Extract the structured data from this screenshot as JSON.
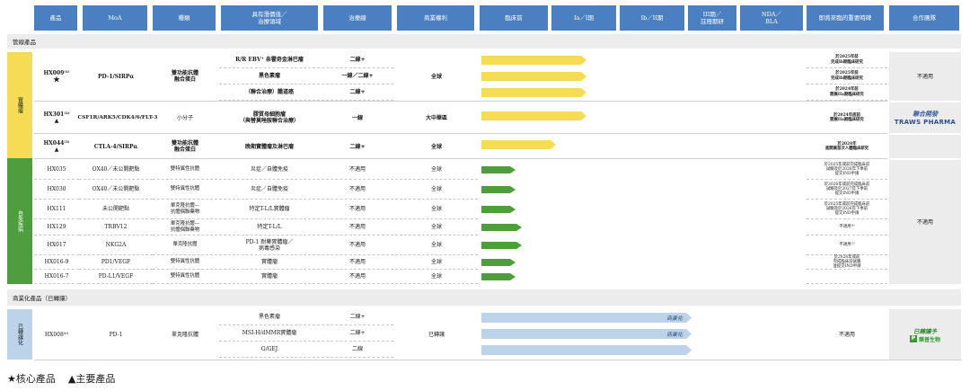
{
  "headers": [
    "產品",
    "MoA",
    "種類",
    "具有潛價值／\n治療領域",
    "治療線",
    "商業權利",
    "臨床前",
    "Ia／I期",
    "Ib／II期",
    "III期／\n註冊期研",
    "NDA／\nBLA",
    "即將來臨的重要時碑",
    "合作團隊"
  ],
  "sections": {
    "pipeline": "管線產品",
    "commercial": "商業化產品（已轉讓）"
  },
  "groups": {
    "yellow": "實體瘤",
    "green": "自免疾病",
    "blue": "已轉讓化"
  },
  "yellow_rows": [
    {
      "product": "",
      "moa": "",
      "type": "",
      "indication": "R/R EBV⁺ 亲霍奇金淋巴瘤",
      "line": "二線+",
      "rights": "",
      "stage": 0.34,
      "milestone": "於2025年前\n完成Ib期臨床研究"
    },
    {
      "product": "",
      "moa": "",
      "type": "",
      "indication": "黑色素瘤",
      "line": "一線／二線+",
      "rights": "",
      "stage": 0.34,
      "milestone": "於2025年前\n完成Ib期臨床研究"
    },
    {
      "product": "",
      "moa": "",
      "type": "",
      "indication": "（聯合治療）膽道癌",
      "line": "二線+",
      "rights": "",
      "stage": 0.34,
      "milestone": "於2024年前\n開展IIa期臨床研究"
    },
    {
      "product": "",
      "moa": "",
      "type": "",
      "indication": "",
      "line": "",
      "rights": "",
      "stage": 0.0,
      "milestone": ""
    },
    {
      "product": "",
      "moa": "",
      "type": "",
      "indication": "",
      "line": "",
      "rights": "",
      "stage": 0.0,
      "milestone": ""
    }
  ],
  "hx009": {
    "name": "HX009⁽¹⁾",
    "mark": "★",
    "moa": "PD-1/SIRPα",
    "type": "雙功能抗體\n融合蛋白",
    "rights": "全球",
    "partner": "不適用"
  },
  "hx301": {
    "name": "HX301⁽²⁾",
    "mark": "▲",
    "moa": "CSF1R/ARK5/CDK4/6/FLT-3",
    "type": "小分子",
    "indication": "膠質母細胞瘤\n（與替莫唑胺聯合治療）",
    "line": "一線",
    "rights": "大中華區",
    "stage": 0.34,
    "milestone": "於2024年底前\n開展IIa期臨床研究"
  },
  "hx044": {
    "name": "HX044⁽³⁾",
    "mark": "▲",
    "moa": "CTLA-4/SIRPα",
    "type": "雙功能抗體\n融合蛋白",
    "indication": "晚期實體瘤及淋巴瘤",
    "line": "二線+",
    "rights": "全球",
    "stage": 0.24,
    "milestone": "於2024年\n底開展首次人體臨床研究"
  },
  "partners": {
    "yellow_top": "不適用",
    "traws_top": "聯合開發",
    "traws_logo": "TRAWS PHARMA",
    "green": "不適用",
    "blue": "已轉讓予",
    "blue_logo": "樂普生物"
  },
  "green_rows": [
    {
      "product": "HX035",
      "moa": "OX40／未公開靶點",
      "type": "雙特異性抗體",
      "indication": "炎症／自體免疫",
      "line": "不適用",
      "rights": "全球",
      "stage": 0.11,
      "milestone": "於2025年或前完成臨床前\n試驗及於2026年下季前\n提交IND申請"
    },
    {
      "product": "HX030",
      "moa": "OX40／未公開靶點",
      "type": "雙特異性抗體",
      "indication": "炎症／自體免疫",
      "line": "不適用",
      "rights": "全球",
      "stage": 0.11,
      "milestone": "於2026年或前完成臨床前\n試驗及於2027年下季前\n提交IND申請"
    },
    {
      "product": "HX111",
      "moa": "未公開靶點",
      "type": "單克隆抗體—\n抗體偶聯藥物",
      "indication": "特定T-L/L實體瘤",
      "line": "不適用",
      "rights": "全球",
      "stage": 0.11,
      "milestone": "於2025年或前完成臨床前\n試驗及於2026年下季前\n提交IND申請"
    },
    {
      "product": "HX129",
      "moa": "TRBV12",
      "type": "單克隆抗體—\n抗體偶聯藥物",
      "indication": "特定T-L/L",
      "line": "不適用",
      "rights": "全球",
      "stage": 0.13,
      "milestone": "不適用⁽⁴⁾"
    },
    {
      "product": "HX017",
      "moa": "NKG2A",
      "type": "單克隆抗體",
      "indication": "PD-1 耐藥實體瘤／\n病毒感染",
      "line": "不適用",
      "rights": "全球",
      "stage": 0.13,
      "milestone": "不適用⁽⁵⁾"
    },
    {
      "product": "HX016-9",
      "moa": "PD1/VEGF",
      "type": "雙特異性抗體",
      "indication": "實體瘤",
      "line": "不適用",
      "rights": "全球",
      "stage": 0.11,
      "milestone": "於2026年或前\n完成臨床前試驗\n並提交IND申請"
    },
    {
      "product": "HX016-7",
      "moa": "PD-L1/VEGF",
      "type": "雙特異性抗體",
      "indication": "實體瘤",
      "line": "不適用",
      "rights": "全球",
      "stage": 0.11,
      "milestone": ""
    }
  ],
  "hx008": {
    "name": "HX008⁽⁶⁾",
    "moa": "PD-1",
    "type": "單克隆抗體",
    "rights": "已轉讓",
    "milestone": "不適用"
  },
  "blue_rows": [
    {
      "indication": "黑色素瘤",
      "line": "二線+",
      "stage": 0.68,
      "label": "商業化"
    },
    {
      "indication": "MSI-H/dMMR實體瘤",
      "line": "二線+",
      "stage": 0.68,
      "label": "商業化"
    },
    {
      "indication": "G/GEJ",
      "line": "二線",
      "stage": 0.68,
      "label": ""
    }
  ],
  "legend": {
    "core": "★核心產品",
    "main": "▲主要產品"
  },
  "colors": {
    "header": "#4a7fc1",
    "yellow": "#f5dc54",
    "green": "#4e9e3e",
    "blue": "#bcd3ea"
  }
}
